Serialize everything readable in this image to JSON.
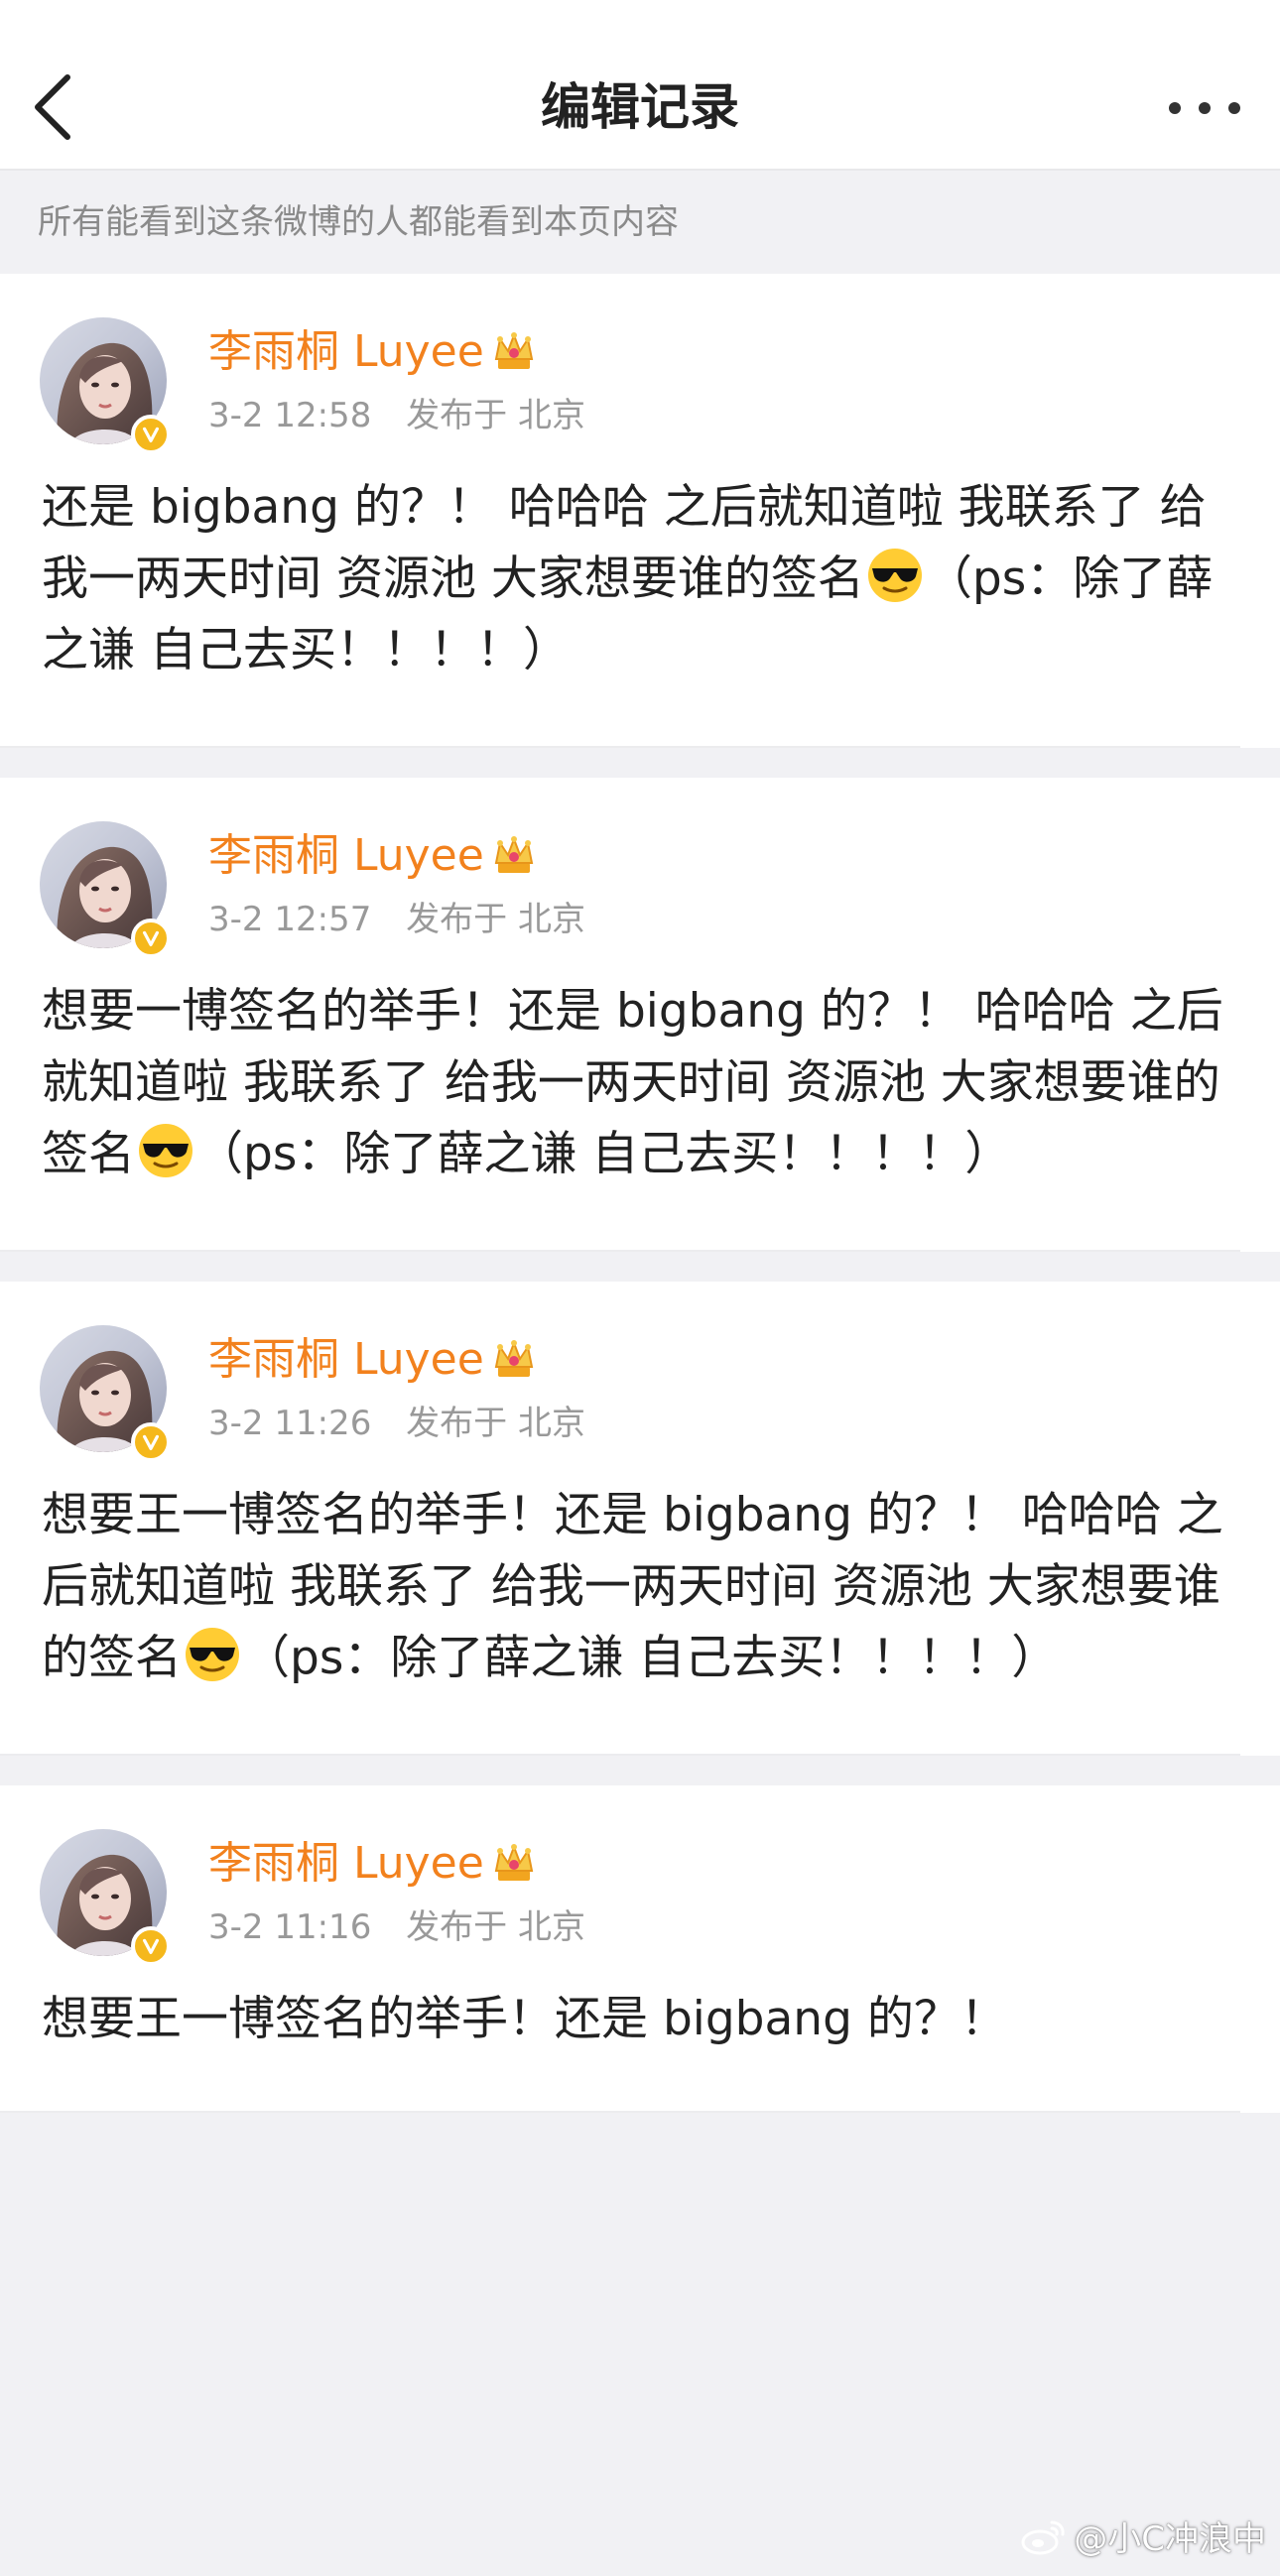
{
  "nav": {
    "title": "编辑记录",
    "back_icon": "chevron-left-icon",
    "more_icon": "more-dots-icon"
  },
  "notice": "所有能看到这条微博的人都能看到本页内容",
  "posts": [
    {
      "username": "李雨桐 Luyee",
      "time": "3-2 12:58",
      "location": "发布于 北京",
      "text_before": "还是 bigbang 的？！ 哈哈哈 之后就知道啦 我联系了 给我一两天时间 资源池 大家想要谁的签名",
      "text_after": "（ps：除了薛之谦 自己去买！！！！）"
    },
    {
      "username": "李雨桐 Luyee",
      "time": "3-2 12:57",
      "location": "发布于 北京",
      "text_before": "想要一博签名的举手！还是 bigbang 的？！ 哈哈哈 之后就知道啦 我联系了 给我一两天时间 资源池 大家想要谁的签名",
      "text_after": "（ps：除了薛之谦 自己去买！！！！）"
    },
    {
      "username": "李雨桐 Luyee",
      "time": "3-2 11:26",
      "location": "发布于 北京",
      "text_before": "想要王一博签名的举手！还是 bigbang 的？！ 哈哈哈 之后就知道啦 我联系了 给我一两天时间 资源池 大家想要谁的签名",
      "text_after": "（ps：除了薛之谦 自己去买！！！！）"
    },
    {
      "username": "李雨桐 Luyee",
      "time": "3-2 11:16",
      "location": "发布于 北京",
      "text_before": "想要王一博签名的举手！还是 bigbang 的？！",
      "text_after": ""
    }
  ],
  "icons": {
    "verified_badge": "verified-v-icon",
    "crown_badge": "crown-icon",
    "emoji": "sunglasses-emoji-icon"
  },
  "colors": {
    "username": "#f2811d",
    "meta": "#999999",
    "background": "#f1f1f4",
    "verified": "#f5b81c"
  },
  "watermark": "@小C冲浪中"
}
